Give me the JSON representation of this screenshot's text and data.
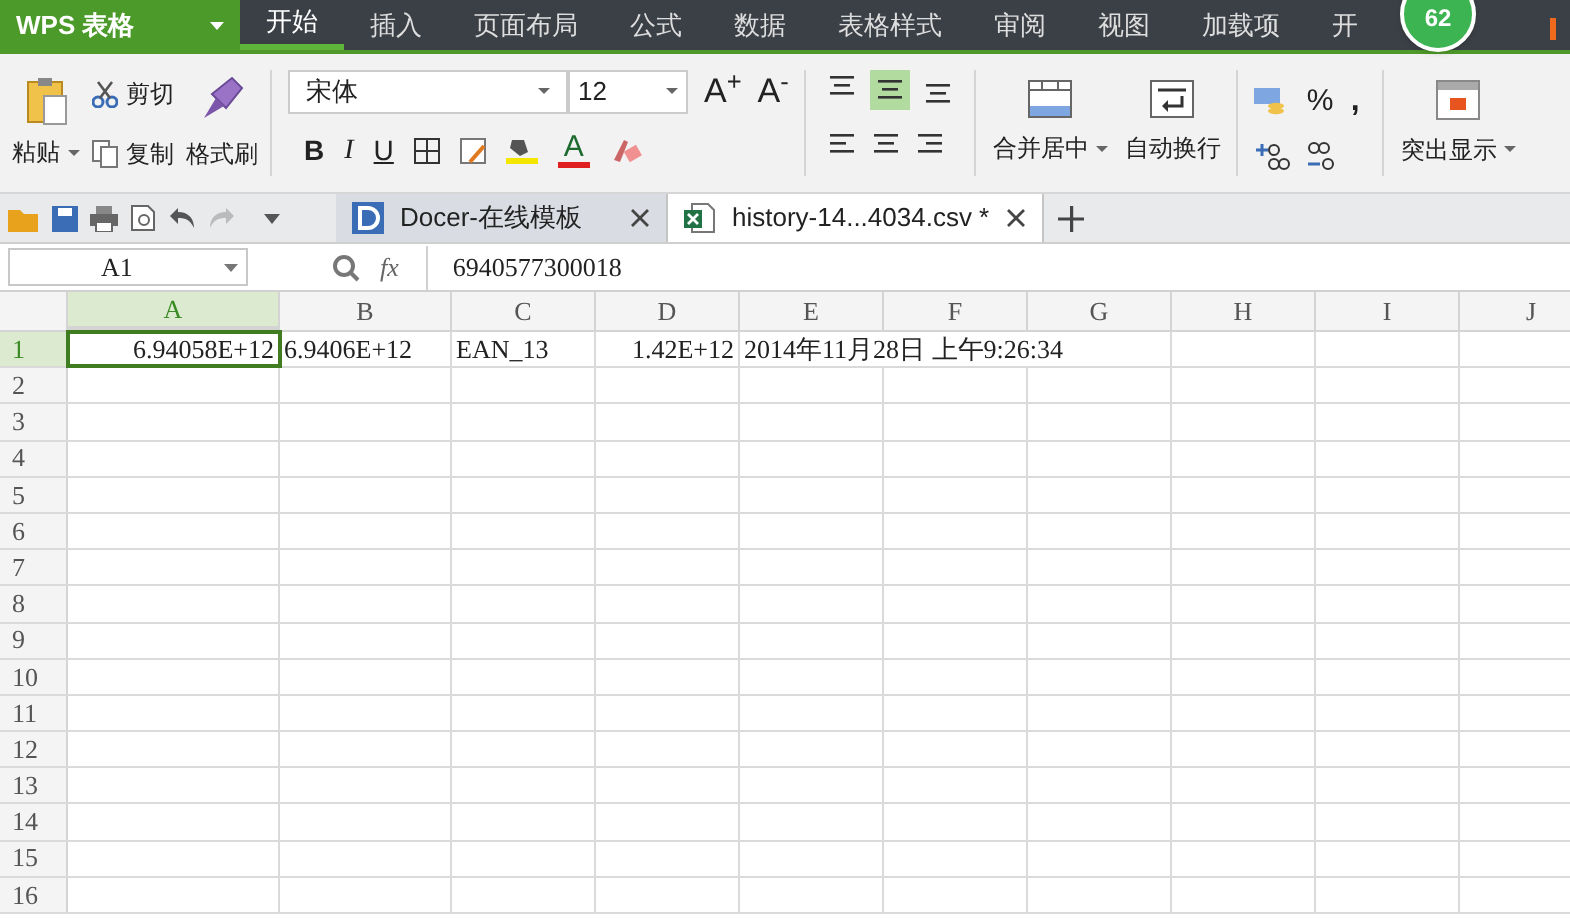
{
  "app": {
    "title": "WPS 表格"
  },
  "menu_tabs": [
    {
      "label": "开始",
      "selected": true
    },
    {
      "label": "插入",
      "selected": false
    },
    {
      "label": "页面布局",
      "selected": false
    },
    {
      "label": "公式",
      "selected": false
    },
    {
      "label": "数据",
      "selected": false
    },
    {
      "label": "表格样式",
      "selected": false
    },
    {
      "label": "审阅",
      "selected": false
    },
    {
      "label": "视图",
      "selected": false
    },
    {
      "label": "加载项",
      "selected": false
    },
    {
      "label": "开",
      "selected": false
    }
  ],
  "badge": "62",
  "ribbon": {
    "paste": "粘贴",
    "cut": "剪切",
    "copy": "复制",
    "format_painter": "格式刷",
    "font_name": "宋体",
    "font_size": "12",
    "grow_font": "A$^{+}$",
    "shrink_font": "A$^{-}$",
    "bold": "B",
    "italic": "I",
    "underline": "U",
    "font_color": "A",
    "align_top": [
      {
        "kind": "top",
        "selected": false
      },
      {
        "kind": "middle",
        "selected": true
      },
      {
        "kind": "bottom",
        "selected": false
      }
    ],
    "merge": "合并居中",
    "wrap": "自动换行",
    "percent": "%",
    "comma": ",",
    "highlight": "突出显示"
  },
  "doc_tabs": [
    {
      "kind": "docer",
      "label": "Docer-在线模板",
      "selected": false
    },
    {
      "kind": "sheet",
      "label": "history-14...4034.csv *",
      "selected": true
    }
  ],
  "formula_bar": {
    "cell": "A1",
    "fx": "fx",
    "value": "6940577300018"
  },
  "sheet": {
    "columns": [
      {
        "label": "A",
        "selected": true
      },
      {
        "label": "B",
        "selected": false
      },
      {
        "label": "C",
        "selected": false
      },
      {
        "label": "D",
        "selected": false
      },
      {
        "label": "E",
        "selected": false
      },
      {
        "label": "F",
        "selected": false
      },
      {
        "label": "G",
        "selected": false
      },
      {
        "label": "H",
        "selected": false
      },
      {
        "label": "I",
        "selected": false
      },
      {
        "label": "J",
        "selected": false
      }
    ],
    "rows": [
      {
        "label": "1",
        "selected": true,
        "cells": [
          "6.94058E+12",
          "6.9406E+12",
          "EAN_13",
          "1.42E+12",
          "2014年11月28日 上午9:26:34"
        ]
      },
      {
        "label": "2",
        "selected": false,
        "cells": []
      },
      {
        "label": "3",
        "selected": false,
        "cells": []
      },
      {
        "label": "4",
        "selected": false,
        "cells": []
      },
      {
        "label": "5",
        "selected": false,
        "cells": []
      },
      {
        "label": "6",
        "selected": false,
        "cells": []
      },
      {
        "label": "7",
        "selected": false,
        "cells": []
      },
      {
        "label": "8",
        "selected": false,
        "cells": []
      },
      {
        "label": "9",
        "selected": false,
        "cells": []
      },
      {
        "label": "10",
        "selected": false,
        "cells": []
      },
      {
        "label": "11",
        "selected": false,
        "cells": []
      },
      {
        "label": "12",
        "selected": false,
        "cells": []
      },
      {
        "label": "13",
        "selected": false,
        "cells": []
      },
      {
        "label": "14",
        "selected": false,
        "cells": []
      },
      {
        "label": "15",
        "selected": false,
        "cells": []
      },
      {
        "label": "16",
        "selected": false,
        "cells": []
      }
    ]
  }
}
